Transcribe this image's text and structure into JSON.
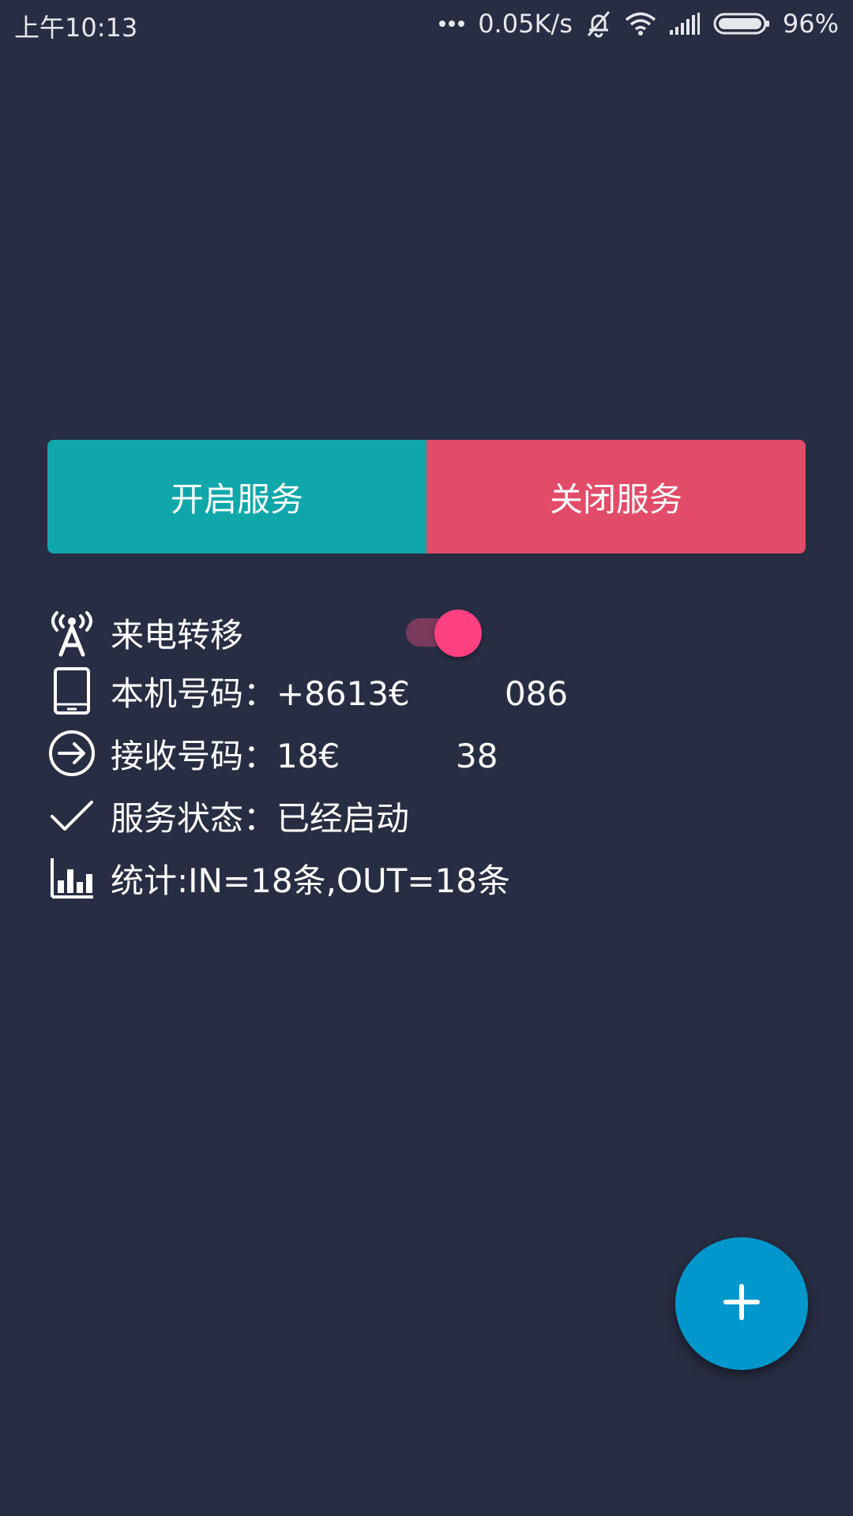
{
  "status_bar": {
    "time": "上午10:13",
    "dots": "•••",
    "network_speed": "0.05K/s",
    "battery_percent": "96%",
    "icons": [
      "more-dots-icon",
      "mute-bell-icon",
      "wifi-icon",
      "signal-icon",
      "battery-icon"
    ]
  },
  "buttons": {
    "start_label": "开启服务",
    "stop_label": "关闭服务",
    "start_color": "#10a7ab",
    "stop_color": "#e24c68"
  },
  "info": {
    "call_forward_label": "来电转移",
    "call_forward_enabled": true,
    "local_number": "本机号码：+8613€         086",
    "receive_number": "接收号码：18€           38",
    "service_status": "服务状态：已经启动",
    "stats": "统计:IN=18条,OUT=18条"
  },
  "fab": {
    "icon": "plus-icon",
    "color": "#0098cc"
  },
  "colors": {
    "background": "#272d42",
    "toggle_thumb": "#ff4081"
  }
}
